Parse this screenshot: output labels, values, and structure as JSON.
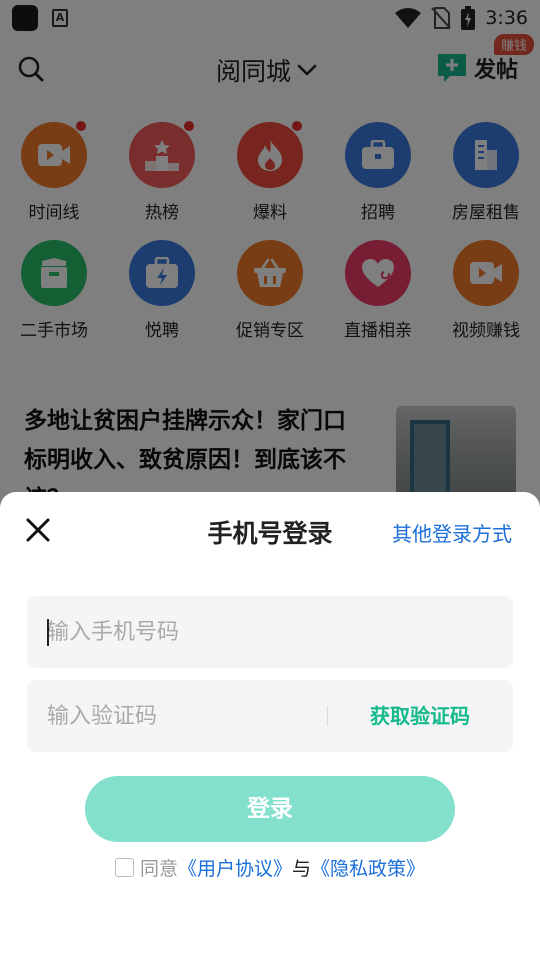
{
  "status_bar": {
    "time": "3:36",
    "icons": [
      "app-icon",
      "a-notification-icon",
      "wifi-icon",
      "no-sim-icon",
      "battery-charging-icon"
    ]
  },
  "header": {
    "search_icon": "search-icon",
    "city": "阅同城",
    "post_label": "发帖",
    "earn_badge": "赚钱"
  },
  "grid": [
    {
      "label": "时间线",
      "icon": "video-icon",
      "color": "#f07a2a",
      "dot": true
    },
    {
      "label": "热榜",
      "icon": "podium-icon",
      "color": "#f25a5a",
      "dot": true
    },
    {
      "label": "爆料",
      "icon": "flame-icon",
      "color": "#f04a3e",
      "dot": true
    },
    {
      "label": "招聘",
      "icon": "briefcase-icon",
      "color": "#3a7be0",
      "dot": false
    },
    {
      "label": "房屋租售",
      "icon": "building-icon",
      "color": "#3a7be0",
      "dot": false
    },
    {
      "label": "二手市场",
      "icon": "box-icon",
      "color": "#2bbf6b",
      "dot": false
    },
    {
      "label": "悦聘",
      "icon": "lightning-briefcase-icon",
      "color": "#3a7be0",
      "dot": false
    },
    {
      "label": "促销专区",
      "icon": "basket-icon",
      "color": "#f07a2a",
      "dot": false
    },
    {
      "label": "直播相亲",
      "icon": "heart-icon",
      "color": "#ef3d6b",
      "dot": false
    },
    {
      "label": "视频赚钱",
      "icon": "video-icon",
      "color": "#f07a2a",
      "dot": false
    }
  ],
  "article": {
    "title_line1": "多地让贫困户挂牌示众！家门口",
    "title_line2": "标明收入、致贫原因！到底该不",
    "title_line3": "该？"
  },
  "login": {
    "title": "手机号登录",
    "other_methods": "其他登录方式",
    "phone_placeholder": "输入手机号码",
    "code_placeholder": "输入验证码",
    "get_code": "获取验证码",
    "login_button": "登录",
    "agree_prefix": "同意",
    "user_agreement": "《用户协议》",
    "and": "与",
    "privacy_policy": "《隐私政策》"
  },
  "colors": {
    "accent_green": "#14b98c",
    "login_button_disabled": "#82e0cc",
    "link_blue": "#1b6fd8",
    "badge_red": "#e8503a"
  }
}
